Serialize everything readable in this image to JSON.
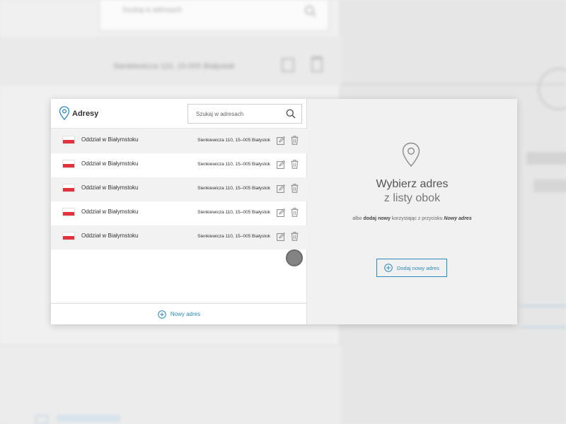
{
  "background": {
    "search_placeholder": "Szukaj w adresach",
    "band_text": "Sienkiewicza 110, 15-005 Białystok"
  },
  "modal": {
    "left": {
      "title": "Adresy",
      "search": {
        "placeholder": "Szukaj w adresach",
        "value": ""
      },
      "rows": [
        {
          "name": "Oddział w Białymstoku",
          "address": "Sienkiewicza 110, 15–005 Białystok"
        },
        {
          "name": "Oddział w Białymstoku",
          "address": "Sienkiewicza 110, 15–005 Białystok"
        },
        {
          "name": "Oddział w Białymstoku",
          "address": "Sienkiewicza 110, 15–005 Białystok"
        },
        {
          "name": "Oddział w Białymstoku",
          "address": "Sienkiewicza 110, 15–005 Białystok"
        },
        {
          "name": "Oddział w Białymstoku",
          "address": "Sienkiewicza 110, 15–005 Białystok"
        }
      ],
      "footer_label": "Nowy adres"
    },
    "right": {
      "title": "Wybierz adres",
      "subtitle": "z listy obok",
      "hint": {
        "prefix": "albo ",
        "bold": "dodaj nowy",
        "middle": " korzystając z przycisku ",
        "italic": "Nowy adres"
      },
      "add_button_label": "Dodaj nowy adres"
    }
  },
  "icons": {
    "pin": "map-pin-icon",
    "search": "search-icon",
    "edit": "edit-icon",
    "delete": "trash-icon",
    "plus": "plus-circle-icon",
    "flag": "poland-flag-icon"
  },
  "colors": {
    "accent": "#2a8ac0",
    "flag_red": "#e2323d",
    "row_alt": "#f2f2f2",
    "right_panel_bg": "#f1f1f1"
  }
}
